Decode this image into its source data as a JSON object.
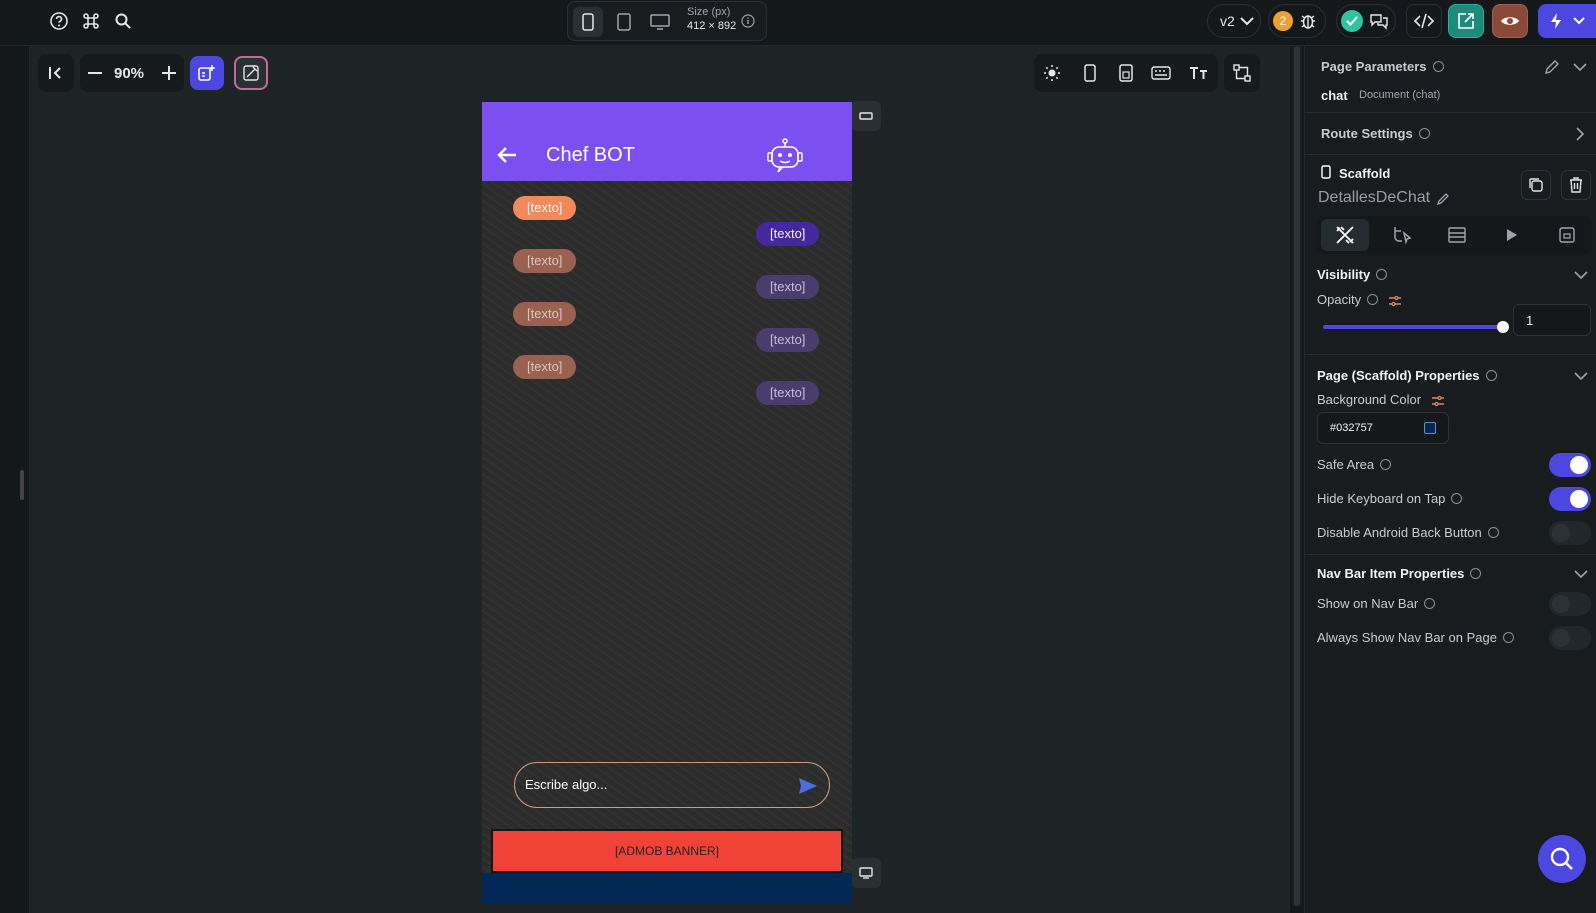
{
  "topbar": {
    "size_label": "Size (px)",
    "size_value": "412 × 892",
    "version": "v2",
    "issues_count": "2"
  },
  "canvas_toolbar": {
    "zoom": "90%"
  },
  "phone": {
    "title": "Chef BOT",
    "left_bubbles": [
      "[texto]",
      "[texto]",
      "[texto]",
      "[texto]"
    ],
    "right_bubbles": [
      "[texto]",
      "[texto]",
      "[texto]",
      "[texto]"
    ],
    "input_placeholder": "Escribe algo...",
    "banner": "[ADMOB BANNER]",
    "footer_color": "#032757",
    "header_color": "#7b4ff0"
  },
  "panel": {
    "page_params_title": "Page Parameters",
    "page_name": "chat",
    "page_doc": "Document (chat)",
    "route_settings": "Route Settings",
    "widget_type": "Scaffold",
    "widget_name": "DetallesDeChat",
    "visibility_title": "Visibility",
    "opacity_label": "Opacity",
    "opacity_value": "1",
    "scaffold_props_title": "Page (Scaffold) Properties",
    "bg_color_label": "Background Color",
    "bg_color_value": "#032757",
    "safe_area_label": "Safe Area",
    "hide_keyboard_label": "Hide Keyboard on Tap",
    "disable_back_label": "Disable Android Back Button",
    "navbar_title": "Nav Bar Item Properties",
    "show_navbar_label": "Show on Nav Bar",
    "always_show_navbar_label": "Always Show Nav Bar on Page"
  },
  "toggles": {
    "safe_area": true,
    "hide_keyboard": true,
    "disable_back": false,
    "show_navbar": false,
    "always_show_navbar": false
  },
  "colors": {
    "accent": "#4b47e0",
    "header_purple": "#7b4ff0",
    "bubble_orange": "#f08a5d",
    "bubble_purple": "#4527a0",
    "banner_red": "#f04236"
  }
}
